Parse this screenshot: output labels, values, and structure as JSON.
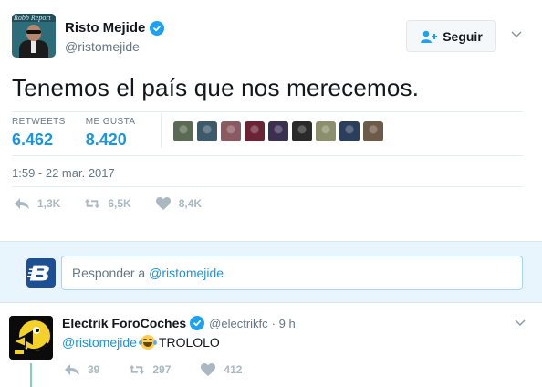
{
  "author": {
    "display_name": "Risto Mejide",
    "handle": "@ristomejide",
    "avatar_icon": "magazine-cover-avatar",
    "avatar_magazine": "Robb Report"
  },
  "follow_button": {
    "label": "Seguir",
    "icon": "add-user-icon"
  },
  "tweet": {
    "text": "Tenemos el país que nos merecemos.",
    "timestamp": "1:59 - 22 mar. 2017"
  },
  "stats": {
    "retweets_label": "RETWEETS",
    "retweets_value": "6.462",
    "likes_label": "ME GUSTA",
    "likes_value": "8.420"
  },
  "likers": [
    {
      "color": "#5b6a54"
    },
    {
      "color": "#3e5a6a"
    },
    {
      "color": "#8a5a62"
    },
    {
      "color": "#6a2436"
    },
    {
      "color": "#3b3050"
    },
    {
      "color": "#2a2a2a"
    },
    {
      "color": "#8c8f6e"
    },
    {
      "color": "#2b3f5c"
    },
    {
      "color": "#6e5a48"
    }
  ],
  "actions": {
    "replies": "1,3K",
    "retweets": "6,5K",
    "likes": "8,4K"
  },
  "reply_box": {
    "prefix": "Responder a",
    "mention": "@ristomejide",
    "avatar_icon": "bold-b-logo-avatar"
  },
  "reply_tweet": {
    "display_name": "Electrik ForoCoches",
    "handle": "@electrikfc",
    "time": "· 9 h",
    "mention": "@ristomejide",
    "text": "TROLOLO",
    "emoji": "face-with-tears-of-joy",
    "avatar_icon": "pixel-duck-avatar",
    "replies": "39",
    "retweets": "297",
    "likes": "412"
  },
  "colors": {
    "accent": "#1b95e0",
    "verified": "#1da1f2",
    "reply_bg": "#e8f5fd",
    "muted": "#657786",
    "action_gray": "#aab8c2"
  }
}
